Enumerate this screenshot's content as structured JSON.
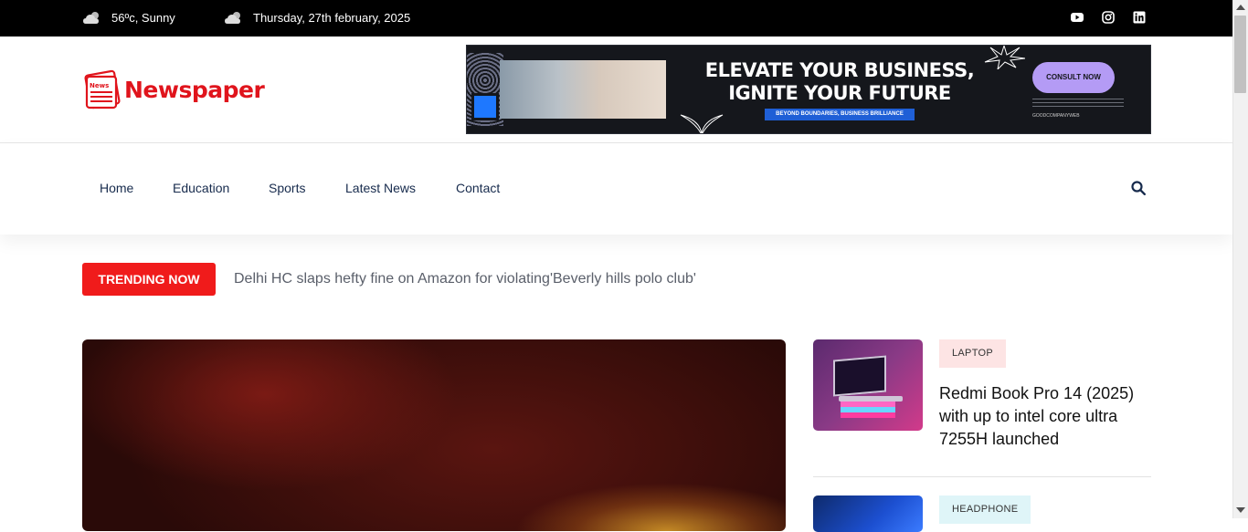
{
  "topbar": {
    "weather": "56ºc, Sunny",
    "date": "Thursday, 27th february, 2025",
    "social": [
      "youtube-icon",
      "instagram-icon",
      "linkedin-icon"
    ]
  },
  "header": {
    "logo_badge": "News",
    "logo_text": "Newspaper",
    "ad": {
      "headline_line1": "ELEVATE YOUR BUSINESS,",
      "headline_line2": "IGNITE YOUR FUTURE",
      "strip": "BEYOND BOUNDARIES, BUSINESS BRILLIANCE",
      "cta": "CONSULT NOW",
      "brand": "GOODCOMPANYWEB"
    }
  },
  "nav": {
    "items": [
      "Home",
      "Education",
      "Sports",
      "Latest News",
      "Contact"
    ]
  },
  "trending": {
    "label": "TRENDING NOW",
    "headline": "Delhi HC slaps hefty fine on Amazon for violating'Beverly hills polo club'"
  },
  "sidebar": {
    "cards": [
      {
        "tag": "LAPTOP",
        "title": "Redmi Book Pro 14 (2025) with up to intel core ultra 7255H launched"
      },
      {
        "tag": "HEADPHONE",
        "title": ""
      }
    ]
  },
  "colors": {
    "accent": "#f01b1b",
    "logo": "#e0141c",
    "topbar": "#000000"
  }
}
